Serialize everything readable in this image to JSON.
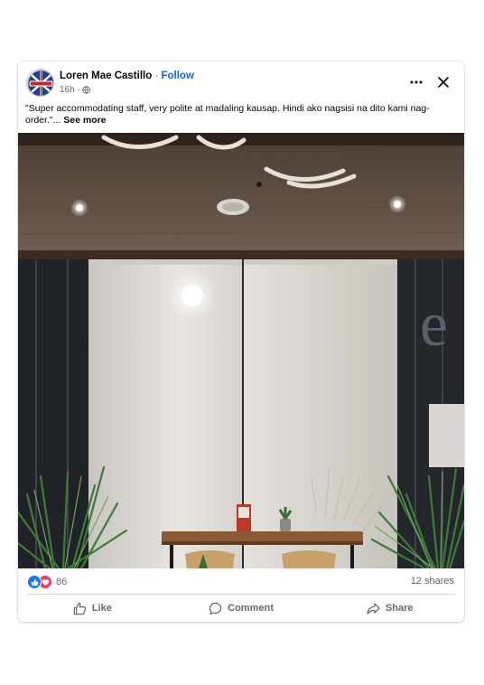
{
  "post": {
    "author": "Loren Mae Castillo",
    "separator": " · ",
    "follow_label": "Follow",
    "timestamp": "16h ·",
    "text": "\"Super accommodating staff, very polite at madaling kausap. Hindi ako nagsisi na dito kami nag-order.\"... ",
    "see_more_label": "See more"
  },
  "stats": {
    "reaction_count": "86",
    "shares": "12 shares"
  },
  "actions": {
    "like": "Like",
    "comment": "Comment",
    "share": "Share"
  },
  "icons": {
    "avatar": "circular-logo-avatar",
    "privacy": "globe-icon",
    "more": "more-options-icon",
    "close": "close-icon",
    "reaction_like": "thumbs-up-reaction-icon",
    "reaction_love": "heart-reaction-icon",
    "like": "thumbs-up-icon",
    "comment": "speech-bubble-icon",
    "share": "share-arrow-icon"
  },
  "colors": {
    "follow": "#0866ff",
    "like_reaction": "#1877f2",
    "love_reaction": "#f33e58",
    "secondary_text": "#65676b"
  }
}
